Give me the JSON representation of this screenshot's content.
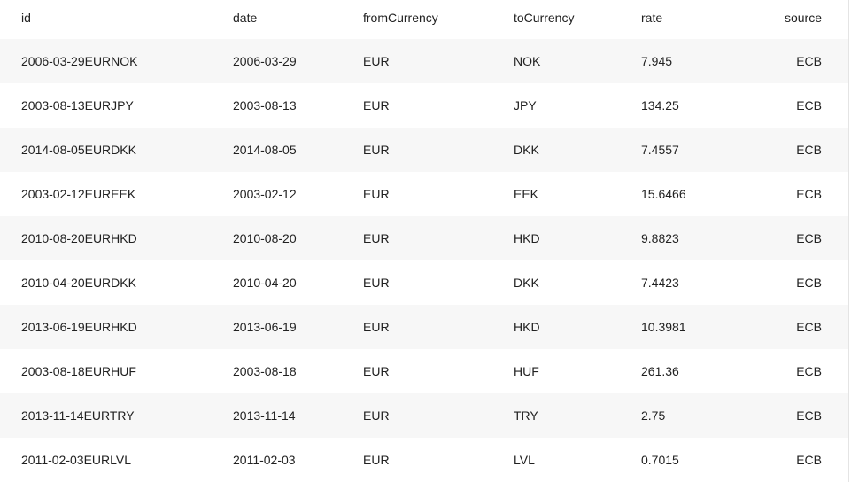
{
  "columns": {
    "id": "id",
    "date": "date",
    "fromCurrency": "fromCurrency",
    "toCurrency": "toCurrency",
    "rate": "rate",
    "source": "source"
  },
  "rows": [
    {
      "id": "2006-03-29EURNOK",
      "date": "2006-03-29",
      "from": "EUR",
      "to": "NOK",
      "rate": "7.945",
      "source": "ECB"
    },
    {
      "id": "2003-08-13EURJPY",
      "date": "2003-08-13",
      "from": "EUR",
      "to": "JPY",
      "rate": "134.25",
      "source": "ECB"
    },
    {
      "id": "2014-08-05EURDKK",
      "date": "2014-08-05",
      "from": "EUR",
      "to": "DKK",
      "rate": "7.4557",
      "source": "ECB"
    },
    {
      "id": "2003-02-12EUREEK",
      "date": "2003-02-12",
      "from": "EUR",
      "to": "EEK",
      "rate": "15.6466",
      "source": "ECB"
    },
    {
      "id": "2010-08-20EURHKD",
      "date": "2010-08-20",
      "from": "EUR",
      "to": "HKD",
      "rate": "9.8823",
      "source": "ECB"
    },
    {
      "id": "2010-04-20EURDKK",
      "date": "2010-04-20",
      "from": "EUR",
      "to": "DKK",
      "rate": "7.4423",
      "source": "ECB"
    },
    {
      "id": "2013-06-19EURHKD",
      "date": "2013-06-19",
      "from": "EUR",
      "to": "HKD",
      "rate": "10.3981",
      "source": "ECB"
    },
    {
      "id": "2003-08-18EURHUF",
      "date": "2003-08-18",
      "from": "EUR",
      "to": "HUF",
      "rate": "261.36",
      "source": "ECB"
    },
    {
      "id": "2013-11-14EURTRY",
      "date": "2013-11-14",
      "from": "EUR",
      "to": "TRY",
      "rate": "2.75",
      "source": "ECB"
    },
    {
      "id": "2011-02-03EURLVL",
      "date": "2011-02-03",
      "from": "EUR",
      "to": "LVL",
      "rate": "0.7015",
      "source": "ECB"
    }
  ],
  "colors": {
    "row_shaded": "#f7f7f7",
    "row_plain": "#ffffff",
    "text": "#212121"
  }
}
